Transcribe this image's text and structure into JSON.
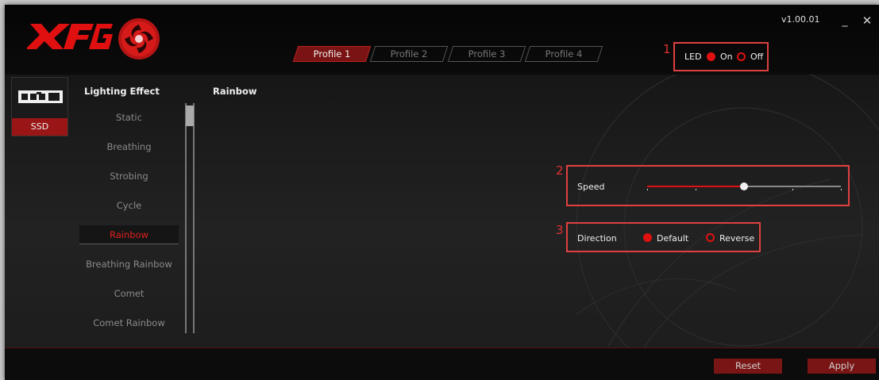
{
  "window": {
    "version": "v1.00.01",
    "minimize_glyph": "_",
    "close_glyph": "✕"
  },
  "brand": {
    "logo_text": "XPG",
    "accent_color": "#e01010"
  },
  "profiles": [
    {
      "label": "Profile 1",
      "active": true
    },
    {
      "label": "Profile 2",
      "active": false
    },
    {
      "label": "Profile 3",
      "active": false
    },
    {
      "label": "Profile 4",
      "active": false
    }
  ],
  "led": {
    "callout": "1",
    "label": "LED",
    "on_label": "On",
    "off_label": "Off",
    "selected": "On"
  },
  "device": {
    "label": "SSD",
    "icon": "ssd-icon"
  },
  "effects": {
    "title": "Lighting Effect",
    "items": [
      "Static",
      "Breathing",
      "Strobing",
      "Cycle",
      "Rainbow",
      "Breathing Rainbow",
      "Comet",
      "Comet Rainbow"
    ],
    "selected": "Rainbow"
  },
  "panel": {
    "title": "Rainbow"
  },
  "speed": {
    "callout": "2",
    "label": "Speed",
    "steps": 5,
    "value_index": 2
  },
  "direction": {
    "callout": "3",
    "label": "Direction",
    "default_label": "Default",
    "reverse_label": "Reverse",
    "selected": "Default"
  },
  "footer": {
    "reset_label": "Reset",
    "apply_label": "Apply"
  }
}
